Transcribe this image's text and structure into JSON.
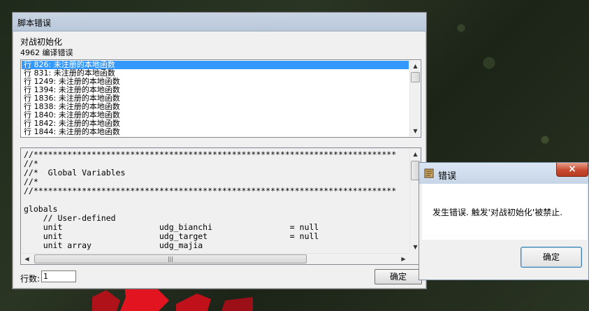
{
  "main_window": {
    "title": "脚本错误",
    "trigger_name": "对战初始化",
    "error_summary": "4962 编译错误",
    "errors": [
      "行 826: 未注册的本地函数",
      "行 831: 未注册的本地函数",
      "行 1249: 未注册的本地函数",
      "行 1394: 未注册的本地函数",
      "行 1836: 未注册的本地函数",
      "行 1838: 未注册的本地函数",
      "行 1840: 未注册的本地函数",
      "行 1842: 未注册的本地函数",
      "行 1844: 未注册的本地函数"
    ],
    "selected_error_index": 0,
    "code_lines": [
      "//***************************************************************************",
      "//*",
      "//*  Global Variables",
      "//*",
      "//***************************************************************************",
      "",
      "globals",
      "    // User-defined",
      "    unit                    udg_bianchi                = null",
      "    unit                    udg_target                 = null",
      "    unit array              udg_majia"
    ],
    "line_label": "行数:",
    "line_value": "1",
    "ok_label": "确定"
  },
  "error_dialog": {
    "title": "错误",
    "close_label": "×",
    "message": "发生错误. 触发'对战初始化'被禁止.",
    "ok_label": "确定"
  },
  "colors": {
    "selection": "#3399ff",
    "dialog_title": "#c6d5e7",
    "close_button": "#c74a30"
  }
}
